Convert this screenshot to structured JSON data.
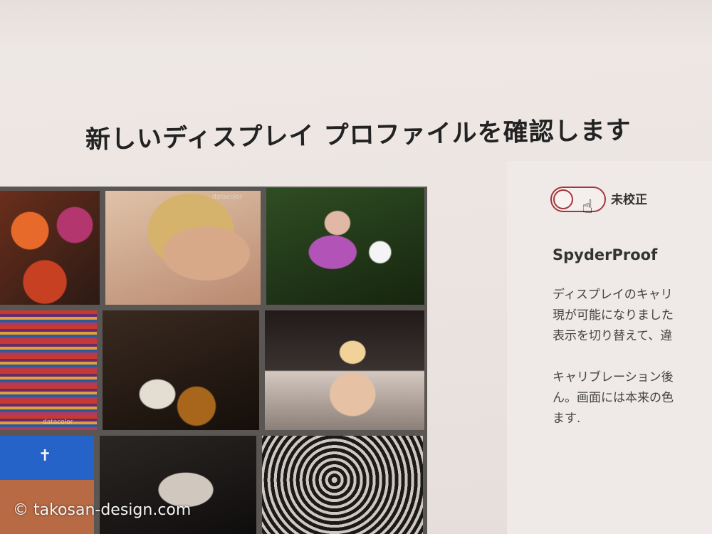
{
  "header": {
    "title": "新しいディスプレイ プロファイルを確認します"
  },
  "gallery": {
    "tile2_caption": "datacolor",
    "tile4_caption": "datacolor"
  },
  "panel": {
    "toggle_label": "未校正",
    "section_title": "SpyderProof",
    "paragraph1": "ディスプレイのキャリ\n現が可能になりました\n表示を切り替えて、違",
    "paragraph2": "キャリブレーション後\nん。画面には本来の色\nます."
  },
  "watermark": "© takosan-design.com"
}
